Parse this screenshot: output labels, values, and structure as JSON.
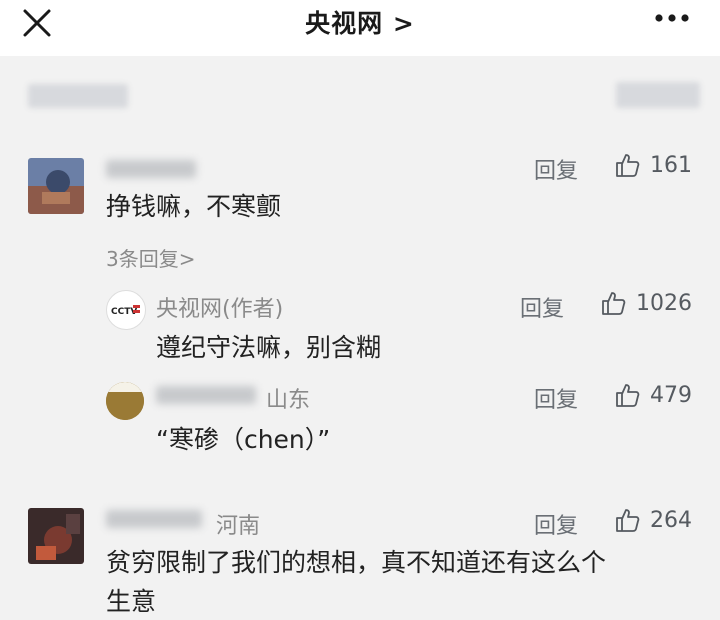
{
  "header": {
    "title": "央视网 >"
  },
  "comments": [
    {
      "text": "挣钱嘛，不寒颤",
      "reply_label": "回复",
      "likes": "161",
      "more_replies": "3条回复>",
      "replies": [
        {
          "author": "央视网(作者)",
          "text": "遵纪守法嘛，别含糊",
          "reply_label": "回复",
          "likes": "1026"
        },
        {
          "location": "山东",
          "text": "“寒碜（chen）”",
          "reply_label": "回复",
          "likes": "479"
        }
      ]
    },
    {
      "location": "河南",
      "text_line1": "贫穷限制了我们的想相，真不知道还有这么个",
      "text_line2": "生意",
      "reply_label": "回复",
      "likes": "264"
    }
  ],
  "icons": {
    "close": "close-icon",
    "more": "more-icon",
    "like": "thumbs-up-icon",
    "author_logo": "cctv-logo"
  },
  "colors": {
    "background": "#f2f2f2",
    "header_bg": "#ffffff",
    "text": "#222222",
    "muted": "#8a8a8a"
  }
}
